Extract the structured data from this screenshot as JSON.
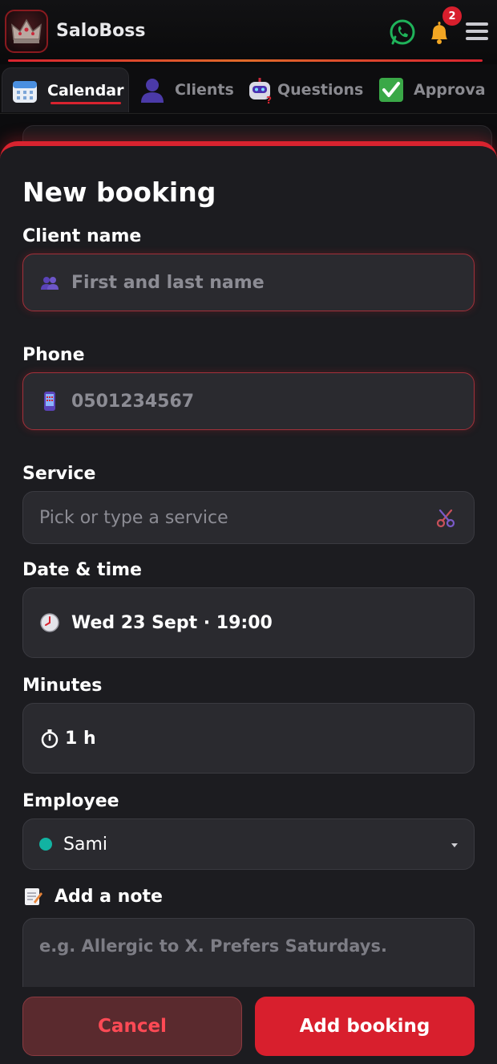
{
  "app": {
    "brand": "SaloBoss",
    "notification_count": "2"
  },
  "tabs": [
    {
      "label": "Calendar",
      "icon": "calendar-icon",
      "active": true
    },
    {
      "label": "Clients",
      "icon": "person-icon",
      "active": false
    },
    {
      "label": "Questions",
      "icon": "robot-icon",
      "active": false
    },
    {
      "label": "Approva",
      "icon": "checkmark-icon",
      "active": false
    }
  ],
  "form": {
    "title": "New booking",
    "client_name": {
      "label": "Client name",
      "placeholder": "First and last name",
      "icon": "people-icon"
    },
    "phone": {
      "label": "Phone",
      "placeholder": "0501234567",
      "icon": "mobile-phone-icon"
    },
    "service": {
      "label": "Service",
      "placeholder": "Pick or type a service",
      "icon": "scissors-icon"
    },
    "datetime": {
      "label": "Date & time",
      "value": "Wed 23 Sept · 19:00",
      "icon": "clock-icon"
    },
    "minutes": {
      "label": "Minutes",
      "value": "1 h",
      "icon": "stopwatch-icon"
    },
    "employee": {
      "label": "Employee",
      "value": "Sami",
      "dot_color": "#12b3a2"
    },
    "note": {
      "label": "Add a note",
      "placeholder": "e.g. Allergic to X. Prefers Saturdays.",
      "icon": "memo-icon"
    }
  },
  "actions": {
    "cancel_label": "Cancel",
    "add_label": "Add booking"
  },
  "colors": {
    "accent": "#d81f2d",
    "sheet_bg": "#1c1c20",
    "field_bg": "#2a2a2f"
  }
}
